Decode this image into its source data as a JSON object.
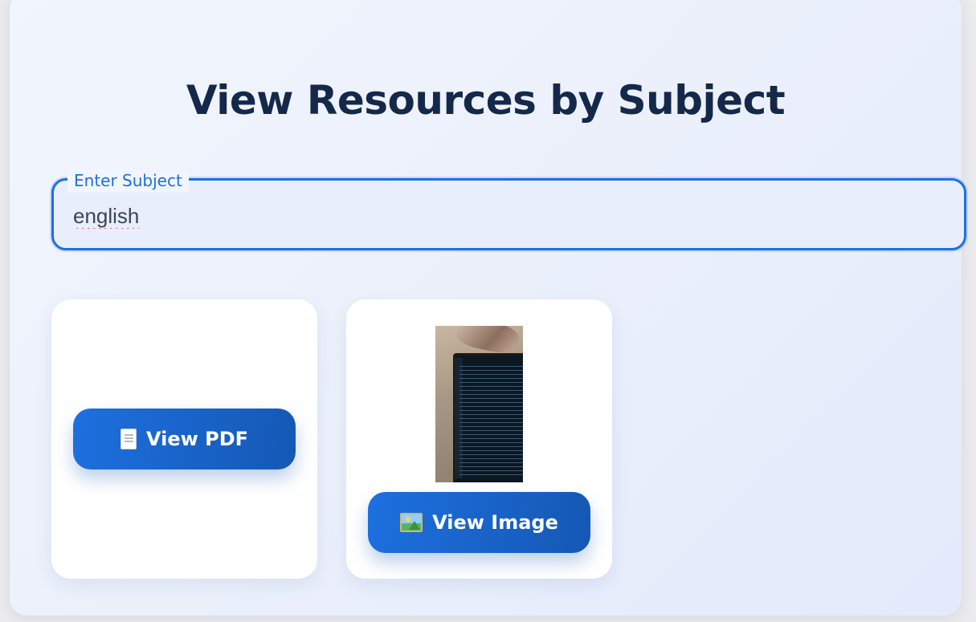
{
  "page": {
    "title": "View Resources by Subject"
  },
  "search": {
    "label": "Enter Subject",
    "value": "english"
  },
  "cards": [
    {
      "button_label": "View PDF",
      "icon": "document-icon"
    },
    {
      "button_label": "View Image",
      "icon": "framed-picture-icon",
      "thumbnail": "laptop-code-photo"
    }
  ]
}
